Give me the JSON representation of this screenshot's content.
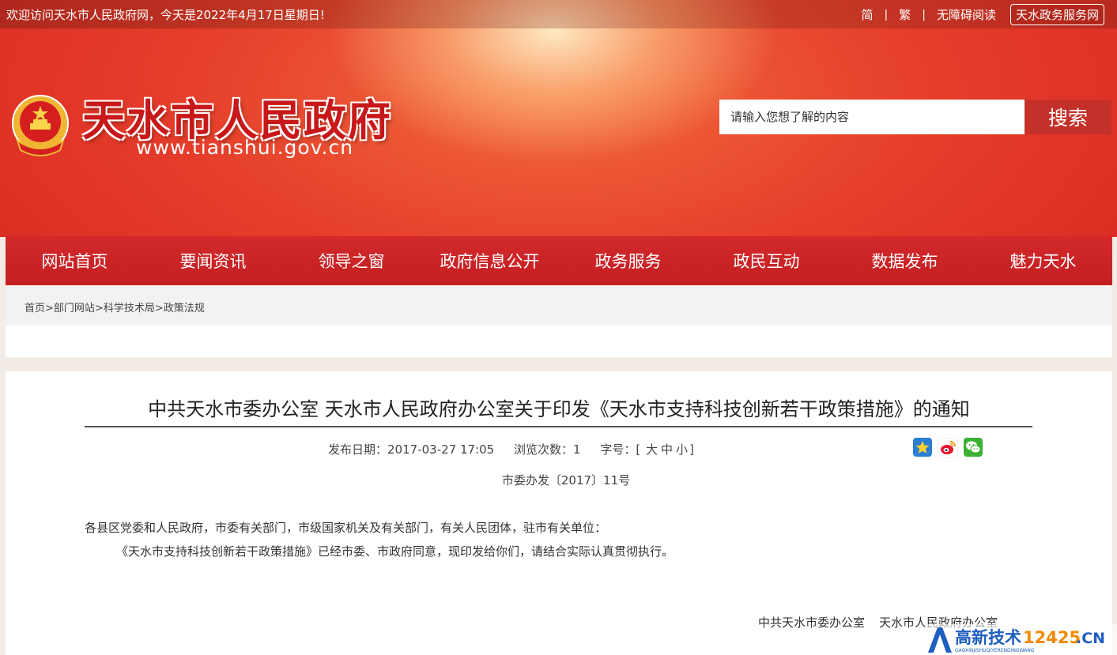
{
  "topbar": {
    "welcome": "欢迎访问天水市人民政府网，今天是2022年4月17日星期日!",
    "simplified": "简",
    "traditional": "繁",
    "accessible": "无障碍阅读",
    "service_link": "天水政务服务网",
    "separator": "|"
  },
  "header": {
    "title": "天水市人民政府",
    "url": "www.tianshui.gov.cn",
    "emblem_icon": "national-emblem-icon"
  },
  "search": {
    "placeholder": "请输入您想了解的内容",
    "button": "搜索"
  },
  "nav": {
    "items": [
      "网站首页",
      "要闻资讯",
      "领导之窗",
      "政府信息公开",
      "政务服务",
      "政民互动",
      "数据发布",
      "魅力天水"
    ]
  },
  "breadcrumb": {
    "items": [
      "首页",
      "部门网站",
      "科学技术局",
      "政策法规"
    ],
    "separator": ">"
  },
  "article": {
    "title": "中共天水市委办公室 天水市人民政府办公室关于印发《天水市支持科技创新若干政策措施》的通知",
    "publish_label": "发布日期：",
    "publish_value": "2017-03-27 17:05",
    "views_label": "浏览次数：",
    "views_value": "1",
    "font_label": "字号：",
    "font_open": "[",
    "font_large": "大",
    "font_medium": "中",
    "font_small": "小",
    "font_close": "]",
    "doc_number": "市委办发〔2017〕11号",
    "para1": "各县区党委和人民政府，市委有关部门，市级国家机关及有关部门，有关人民团体，驻市有关单位：",
    "para2": "《天水市支持科技创新若干政策措施》已经市委、市政府同意，现印发给你们，请结合实际认真贯彻执行。",
    "signer1": "中共天水市委办公室",
    "signer2": "天水市人民政府办公室"
  },
  "watermark": {
    "text": "高新技术",
    "number": "12425",
    "suffix": ".CN",
    "sub": "GAOXINJISHUQIYERENDINGWANG"
  },
  "colors": {
    "brand_red": "#c8181a",
    "nav_red": "#c31f22",
    "search_button": "#c4312a"
  }
}
